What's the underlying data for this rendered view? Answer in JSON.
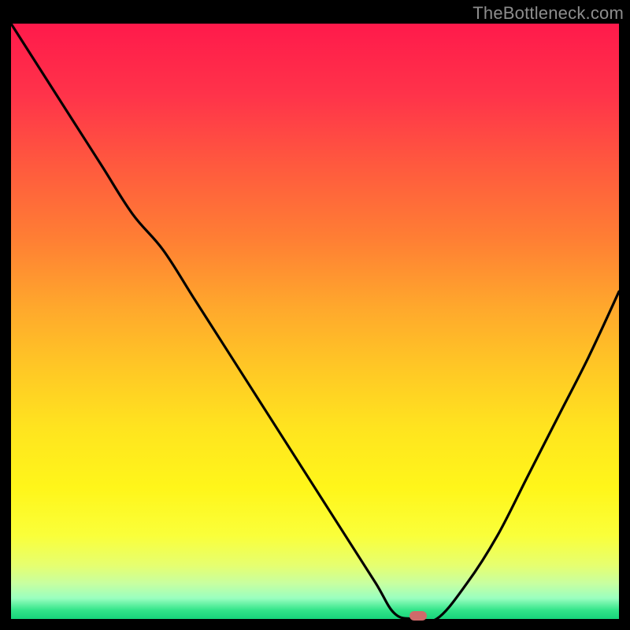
{
  "watermark": "TheBottleneck.com",
  "chart_data": {
    "type": "line",
    "title": "",
    "xlabel": "",
    "ylabel": "",
    "xlim": [
      0,
      100
    ],
    "ylim": [
      0,
      100
    ],
    "x": [
      0,
      5,
      10,
      15,
      20,
      25,
      30,
      35,
      40,
      45,
      50,
      55,
      60,
      63,
      66,
      70,
      75,
      80,
      85,
      90,
      95,
      100
    ],
    "y": [
      100,
      92,
      84,
      76,
      68,
      62,
      54,
      46,
      38,
      30,
      22,
      14,
      6,
      1,
      0,
      0,
      6,
      14,
      24,
      34,
      44,
      55
    ],
    "marker": {
      "x": 67,
      "y": 0
    },
    "note": "Values estimated from pixel positions; y=0 is chart bottom (green), y=100 is chart top (red)."
  },
  "colors": {
    "curve": "#000000",
    "marker": "#cf6a6a",
    "frame": "#000000"
  }
}
